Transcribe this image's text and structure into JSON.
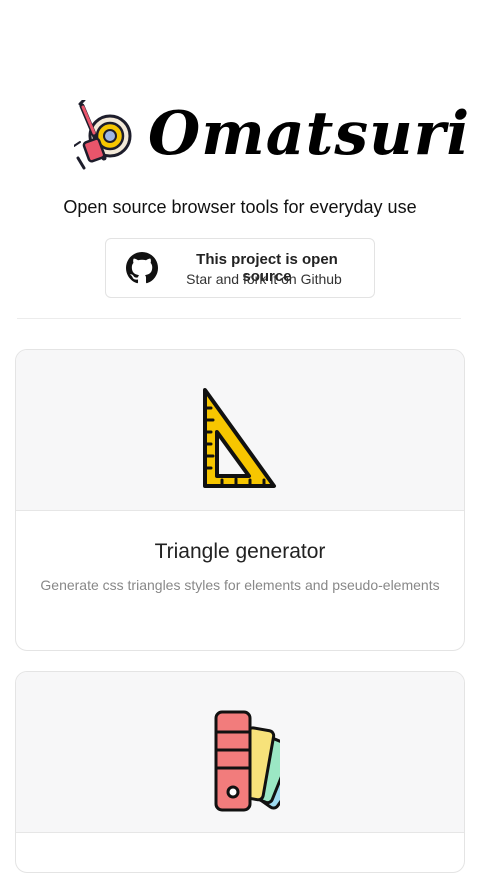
{
  "brand": {
    "name": "Omatsuri",
    "tagline": "Open source browser tools for everyday use",
    "logo_icon": "festival-drum-icon"
  },
  "github": {
    "title": "This project is open source",
    "subtitle": "Star and fork it on Github",
    "icon": "github-icon"
  },
  "tools": [
    {
      "title": "Triangle generator",
      "description": "Generate css triangles styles for elements and pseudo-elements",
      "icon": "set-square-icon"
    },
    {
      "title": "",
      "description": "",
      "icon": "color-palette-fan-icon"
    }
  ],
  "colors": {
    "accent_yellow": "#f7c600",
    "palette_red": "#f27c7c",
    "palette_yellow": "#f7e27a",
    "palette_green": "#9be7c4",
    "palette_blue": "#9fdaf0"
  }
}
